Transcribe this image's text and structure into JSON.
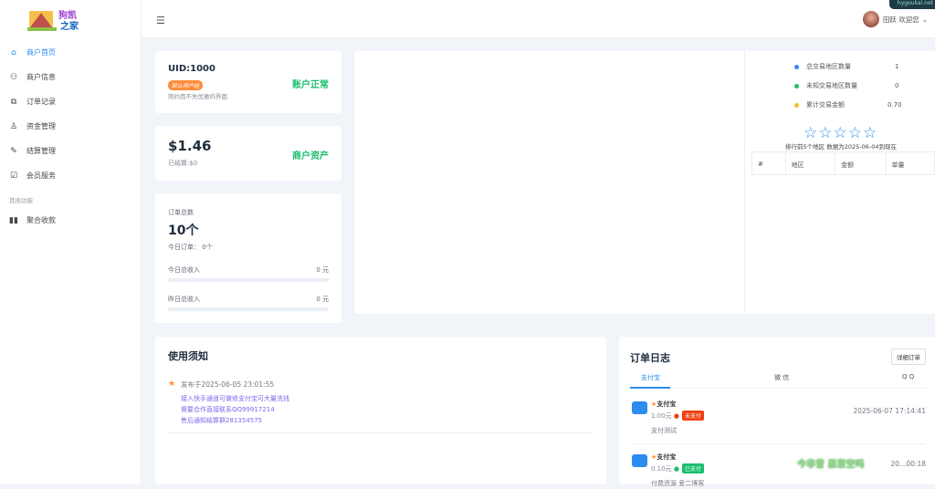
{
  "sidebar": {
    "logo_text": "狗凯之家",
    "items": [
      {
        "label": "商户首页",
        "icon": "home-icon"
      },
      {
        "label": "商户信息",
        "icon": "users-icon"
      },
      {
        "label": "订单记录",
        "icon": "orders-icon"
      },
      {
        "label": "资金管理",
        "icon": "funds-icon"
      },
      {
        "label": "结算管理",
        "icon": "edit-icon"
      },
      {
        "label": "会员服务",
        "icon": "checkbox-icon"
      }
    ],
    "group": "其他功能",
    "extra": {
      "label": "聚合收款",
      "icon": "barcode-icon"
    }
  },
  "topbar": {
    "user": "田跃 欢迎您",
    "corner_text": "hygoukai.net"
  },
  "uid_card": {
    "uid": "UID:1000",
    "group_badge": "默认用户组",
    "desc": "简约而不失优雅的界面",
    "status": "账户正常"
  },
  "asset_card": {
    "balance": "$1.46",
    "settled": "已结算:$0",
    "label": "商户资产"
  },
  "order_card": {
    "title": "订单总数",
    "total": "10个",
    "today_label": "今日订单：",
    "today": "0个",
    "today_income_label": "今日总收入",
    "today_income": "0 元",
    "yesterday_income_label": "昨日总收入",
    "yesterday_income": "0 元"
  },
  "region": {
    "stats": [
      {
        "label": "总交易地区数量",
        "value": "1",
        "color": "#2d8cf0"
      },
      {
        "label": "未知交易地区数量",
        "value": "0",
        "color": "#19be6b"
      },
      {
        "label": "累计交易金额",
        "value": "0.70",
        "color": "#f7ba2a"
      }
    ],
    "stars": "☆☆☆☆☆",
    "caption": "排行前5个地区 数据为2025-06-04到现在",
    "columns": [
      "#",
      "地区",
      "金额",
      "单量"
    ]
  },
  "notice": {
    "title": "使用须知",
    "date": "发布于2025-06-05 23:01:55",
    "lines": [
      "接入快手通道可做修支付宝可大量洗钱",
      "需要合作直接联系QQ99917214",
      "售后通知结算群281354575"
    ]
  },
  "log": {
    "title": "订单日志",
    "detail_button": "详细订单",
    "tabs": [
      "支付宝",
      "微 信",
      "Q Q"
    ],
    "orders": [
      {
        "name": "支付宝",
        "amount": "1.00元",
        "status": "未支付",
        "status_color": "#ed4014",
        "time": "2025-06-07 17:14:41",
        "note": "支付测试"
      },
      {
        "name": "支付宝",
        "amount": "0.10元",
        "status": "已支付",
        "status_color": "#19be6b",
        "time": "20…00:18",
        "note": "付费资源 爱二博客"
      }
    ],
    "watermark": "今非昔 恶意空吗"
  }
}
